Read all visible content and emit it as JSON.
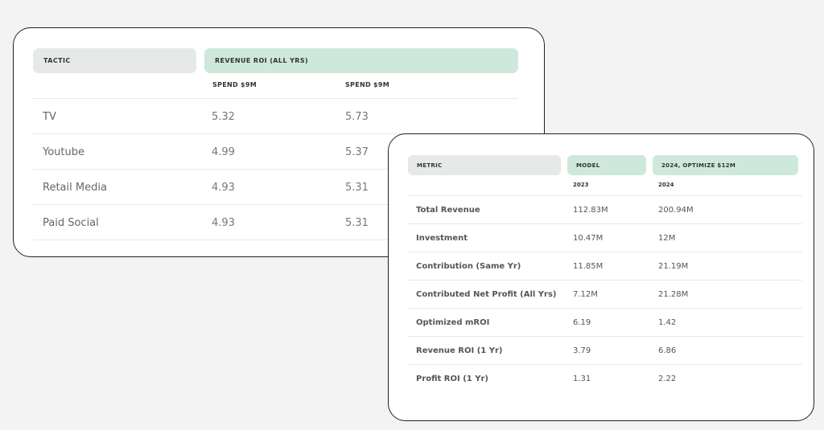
{
  "roi_table": {
    "headers": {
      "tactic": "TACTIC",
      "revenue_roi": "REVENUE ROI (ALL YRS)"
    },
    "subheaders": [
      "SPEND $9M",
      "SPEND $9M"
    ],
    "rows": [
      {
        "tactic": "TV",
        "v1": "5.32",
        "v2": "5.73"
      },
      {
        "tactic": "Youtube",
        "v1": "4.99",
        "v2": "5.37"
      },
      {
        "tactic": "Retail Media",
        "v1": "4.93",
        "v2": "5.31"
      },
      {
        "tactic": "Paid Social",
        "v1": "4.93",
        "v2": "5.31"
      }
    ]
  },
  "metrics_table": {
    "headers": {
      "metric": "METRIC",
      "model": "MODEL",
      "optimize": "2024, OPTIMIZE $12M"
    },
    "subheaders": [
      "2023",
      "2024"
    ],
    "rows": [
      {
        "metric": "Total Revenue",
        "v1": "112.83M",
        "v2": "200.94M"
      },
      {
        "metric": "Investment",
        "v1": "10.47M",
        "v2": "12M"
      },
      {
        "metric": "Contribution (Same Yr)",
        "v1": "11.85M",
        "v2": "21.19M"
      },
      {
        "metric": "Contributed Net Profit (All Yrs)",
        "v1": "7.12M",
        "v2": "21.28M"
      },
      {
        "metric": "Optimized mROI",
        "v1": "6.19",
        "v2": "1.42"
      },
      {
        "metric": "Revenue ROI (1 Yr)",
        "v1": "3.79",
        "v2": "6.86"
      },
      {
        "metric": "Profit ROI (1 Yr)",
        "v1": "1.31",
        "v2": "2.22"
      }
    ]
  },
  "colors": {
    "header_green": "#cfe8dc",
    "header_gray": "#e6e9e8",
    "background": "#f2f3f2"
  }
}
